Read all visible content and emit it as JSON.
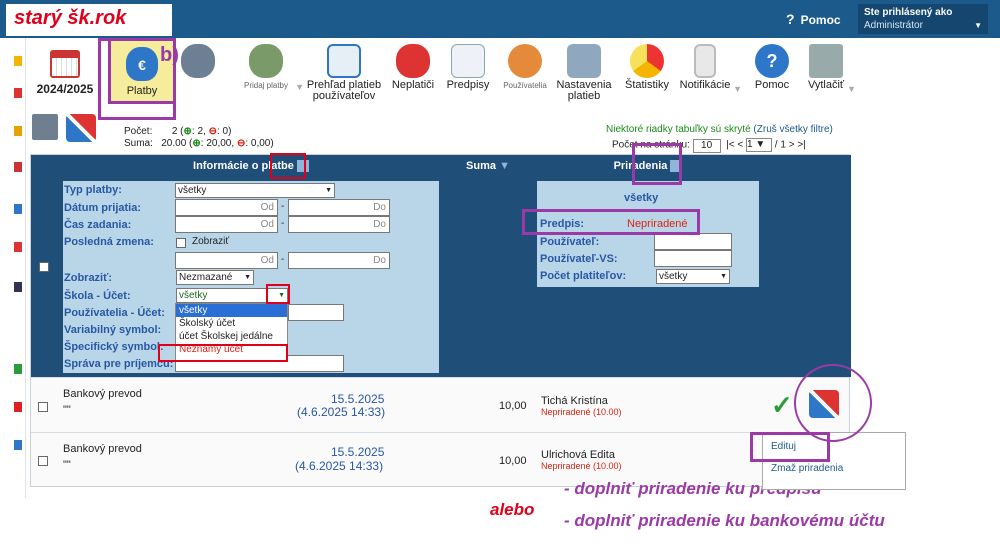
{
  "banner": "starý šk.rok",
  "header": {
    "help": "Pomoc",
    "user_line1": "Ste prihlásený ako",
    "user_line2": "Administrátor"
  },
  "toolbar": {
    "year": "2024/2025",
    "items": [
      {
        "label": "Platby"
      },
      {
        "label": ""
      },
      {
        "label": "Pridaj platby"
      },
      {
        "label": "Prehľad platieb používateľov"
      },
      {
        "label": "Neplatiči"
      },
      {
        "label": "Predpisy"
      },
      {
        "label": "Používatelia"
      },
      {
        "label": "Nastavenia platieb"
      },
      {
        "label": "Štatistiky"
      },
      {
        "label": "Notifikácie"
      },
      {
        "label": "Pomoc"
      },
      {
        "label": "Vytlačiť"
      }
    ]
  },
  "annotation_b": "b)",
  "summary": {
    "count_label": "Počet:",
    "count_value": "2",
    "count_plus": "2,",
    "count_minus": "0)",
    "sum_label": "Suma:",
    "sum_value": "20.00",
    "sum_plus": "20,00,",
    "sum_minus": "0,00)"
  },
  "hidden_note": "Niektoré riadky tabuľky sú skryté",
  "hidden_link": "(Zruš všetky filtre)",
  "pager": {
    "label": "Počet na stránku:",
    "per_page": "10",
    "page": "1",
    "total": "/ 1",
    "nav_prev": "|< <",
    "nav_next": "> >|"
  },
  "grid": {
    "h_info": "Informácie o platbe",
    "h_suma": "Suma",
    "h_prir": "Priradenia",
    "filters": {
      "typ": "Typ platby:",
      "typ_val": "všetky",
      "datum": "Dátum prijatia:",
      "cas": "Čas zadania:",
      "zmena": "Posledná zmena:",
      "zobrazit_chk": "Zobraziť",
      "zobrazit": "Zobraziť:",
      "zobrazit_val": "Nezmazané",
      "skola": "Škola - Účet:",
      "skola_val": "všetky",
      "pouz": "Používatelia - Účet:",
      "vs": "Variabilný symbol:",
      "ss": "Špecifický symbol:",
      "sprava": "Správa pre príjemcu:",
      "od": "Od",
      "do": "Do",
      "prir_all": "všetky",
      "predpis": "Predpis:",
      "predpis_val": "Nepriradené",
      "pouzivatel": "Používateľ:",
      "pouzivatel_vs": "Používateľ-VS:",
      "pocet": "Počet platiteľov:",
      "pocet_val": "všetky"
    },
    "dropdown": [
      "všetky",
      "Školský účet",
      "účet Školskej jedálne",
      "Neznámy účet"
    ]
  },
  "rows": [
    {
      "typ": "Bankový prevod",
      "note": "\"\"",
      "date": "15.5.2025",
      "time": "(4.6.2025 14:33)",
      "sum": "10,00",
      "name": "Tichá Kristína",
      "state": "Nepriradené (10.00)"
    },
    {
      "typ": "Bankový prevod",
      "note": "\"\"",
      "date": "15.5.2025",
      "time": "(4.6.2025 14:33)",
      "sum": "10,00",
      "name": "Ulrichová Edita",
      "state": "Nepriradené (10.00)"
    }
  ],
  "popup": {
    "edit": "Edituj",
    "delete": "Zmaž priradenia"
  },
  "notes": {
    "alebo": "alebo",
    "n1": "- doplniť priradenie ku predpisu",
    "n2": "- doplniť priradenie ku bankovému účtu"
  },
  "colors": {
    "header": "#1d5a8c",
    "accent": "#9b3aa6",
    "red": "#e0001b"
  }
}
